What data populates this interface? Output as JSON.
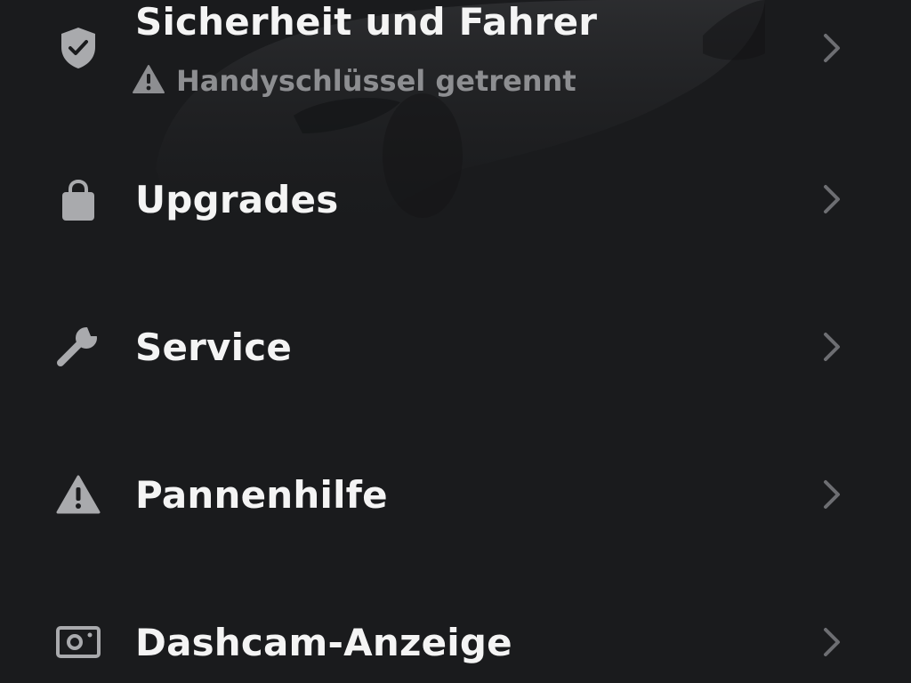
{
  "theme": {
    "background": "#1a1b1d",
    "title_color": "#f4f4f4",
    "subtitle_color": "#8d8e91",
    "icon_color": "#a9aaad",
    "chevron_color": "#6d6e72"
  },
  "menu": {
    "items": [
      {
        "icon": "shield-check-icon",
        "label": "Sicherheit und Fahrer",
        "status": {
          "icon": "warning-icon",
          "text": "Handyschlüssel getrennt"
        }
      },
      {
        "icon": "shopping-bag-icon",
        "label": "Upgrades"
      },
      {
        "icon": "wrench-icon",
        "label": "Service"
      },
      {
        "icon": "warning-triangle-icon",
        "label": "Pannenhilfe"
      },
      {
        "icon": "dashcam-icon",
        "label": "Dashcam-Anzeige"
      }
    ]
  }
}
